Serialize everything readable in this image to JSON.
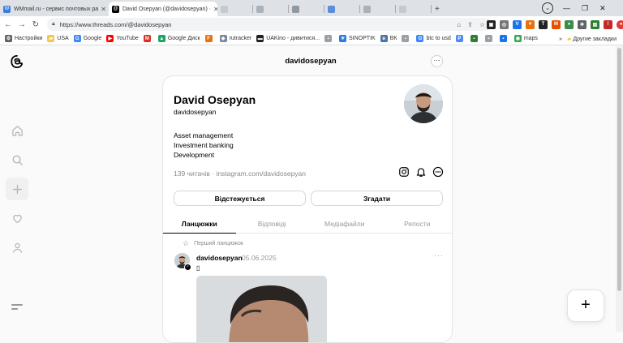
{
  "browser": {
    "tabs": [
      {
        "title": "WMmail.ru - сервис почтовых ра",
        "favicon_color": "#3b7dd8",
        "favicon_icon": "wmmail-icon",
        "active": false
      },
      {
        "title": "David Osepyan (@davidosepyan) ·",
        "favicon_color": "#000000",
        "favicon_icon": "threads-icon",
        "active": true
      },
      {
        "title": "",
        "favicon_color": "#9aa0a6",
        "favicon_icon": "page-icon",
        "active": false
      },
      {
        "title": "",
        "favicon_color": "#9aa0a6",
        "favicon_icon": "page-icon",
        "active": false
      },
      {
        "title": "",
        "favicon_color": "#9aa0a6",
        "favicon_icon": "page-icon",
        "active": false
      },
      {
        "title": "",
        "favicon_color": "#9aa0a6",
        "favicon_icon": "page-icon",
        "active": false
      },
      {
        "title": "",
        "favicon_color": "#9aa0a6",
        "favicon_icon": "page-icon",
        "active": false
      },
      {
        "title": "",
        "favicon_color": "#9aa0a6",
        "favicon_icon": "page-icon",
        "active": false
      }
    ],
    "new_tab": "+",
    "url": "https://www.threads.com/@davidosepyan",
    "bookmarks": [
      {
        "label": "Настройки",
        "icon": "gear-icon",
        "color": "#5f6368"
      },
      {
        "label": "USA",
        "icon": "folder-icon",
        "color": "#f2c94c"
      },
      {
        "label": "Google",
        "icon": "google-icon",
        "color": "#4285f4"
      },
      {
        "label": "YouTube",
        "icon": "youtube-icon",
        "color": "#ff0000"
      },
      {
        "label": "",
        "icon": "gmail-icon",
        "color": "#d93025"
      },
      {
        "label": "Google Диск",
        "icon": "drive-icon",
        "color": "#1fa463"
      },
      {
        "label": "",
        "icon": "fl-icon",
        "color": "#e8710a"
      },
      {
        "label": "rutracker",
        "icon": "rutracker-icon",
        "color": "#7b8a9a"
      },
      {
        "label": "UAKino - дивитися...",
        "icon": "uakino-icon",
        "color": "#222222"
      },
      {
        "label": "",
        "icon": "bookmark-icon",
        "color": "#9aa0a6"
      },
      {
        "label": "SINOPTIK",
        "icon": "sinoptik-icon",
        "color": "#2b7bd8"
      },
      {
        "label": "ВК",
        "icon": "vk-icon",
        "color": "#4c75a3"
      },
      {
        "label": "",
        "icon": "bookmark-icon",
        "color": "#9aa0a6"
      },
      {
        "label": "btc to usd",
        "icon": "google-icon",
        "color": "#4285f4"
      },
      {
        "label": "",
        "icon": "p-icon",
        "color": "#4c8bf5"
      },
      {
        "label": "",
        "icon": "bookmark-icon",
        "color": "#2e7d32"
      },
      {
        "label": "",
        "icon": "bookmark-icon",
        "color": "#9aa0a6"
      },
      {
        "label": "",
        "icon": "bookmark-icon",
        "color": "#1a73e8"
      },
      {
        "label": "maps",
        "icon": "maps-icon",
        "color": "#34a853"
      }
    ],
    "other_bookmarks": "Другие закладки",
    "more_bookmarks": "»"
  },
  "threads": {
    "page_title": "davidosepyan",
    "more_label": "···",
    "profile": {
      "display_name": "David Osepyan",
      "username": "davidosepyan",
      "bio": [
        "Asset management",
        "Investment banking",
        "Development"
      ],
      "followers": "139 читачів · instagram.com/davidosepyan"
    },
    "buttons": {
      "unfollow": "Відстежується",
      "mention": "Згадати"
    },
    "tabs": [
      "Ланцюжки",
      "Відповіді",
      "Медіафайли",
      "Репости"
    ],
    "active_tab": 0,
    "pinned_label": "Перший ланцюжок",
    "post": {
      "username": "davidosepyan",
      "date": "05.06.2025",
      "more": "···",
      "text": "▯"
    },
    "fab_label": "+"
  },
  "colors": {
    "brand_text": "#000000",
    "muted_text": "#8a8a8a",
    "background": "#fafafa"
  }
}
